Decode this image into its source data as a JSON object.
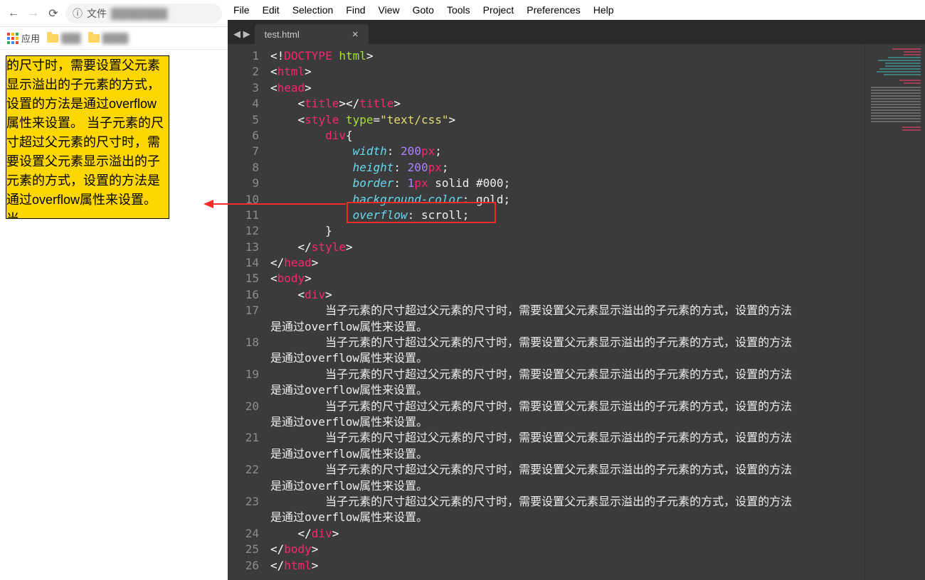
{
  "browser": {
    "address_prefix": "文件",
    "apps_label": "应用",
    "rendered_text": "的尺寸时，需要设置父元素显示溢出的子元素的方式，设置的方法是通过overflow属性来设置。 当子元素的尺寸超过父元素的尺寸时，需要设置父元素显示溢出的子元素的方式，设置的方法是通过overflow属性来设置。 当"
  },
  "editor": {
    "menus": [
      "File",
      "Edit",
      "Selection",
      "Find",
      "View",
      "Goto",
      "Tools",
      "Project",
      "Preferences",
      "Help"
    ],
    "tab_title": "test.html",
    "code_lines": [
      {
        "n": 1,
        "html": "<span class='t-angle'>&lt;!</span><span class='t-kw'>DOCTYPE</span> <span class='t-attr'>html</span><span class='t-angle'>&gt;</span>"
      },
      {
        "n": 2,
        "html": "<span class='t-angle'>&lt;</span><span class='t-tag'>html</span><span class='t-angle'>&gt;</span>"
      },
      {
        "n": 3,
        "html": "<span class='t-angle'>&lt;</span><span class='t-tag'>head</span><span class='t-angle'>&gt;</span>"
      },
      {
        "n": 4,
        "html": "    <span class='t-angle'>&lt;</span><span class='t-tag'>title</span><span class='t-angle'>&gt;&lt;/</span><span class='t-tag'>title</span><span class='t-angle'>&gt;</span>"
      },
      {
        "n": 5,
        "html": "    <span class='t-angle'>&lt;</span><span class='t-tag'>style</span> <span class='t-attr'>type</span><span class='t-punct'>=</span><span class='t-val'>\"text/css\"</span><span class='t-angle'>&gt;</span>"
      },
      {
        "n": 6,
        "html": "        <span class='t-tag'>div</span><span class='t-punct'>{</span>"
      },
      {
        "n": 7,
        "html": "            <span class='t-prop'>width</span><span class='t-punct'>:</span> <span class='t-num'>200</span><span class='t-unit'>px</span><span class='t-punct'>;</span>"
      },
      {
        "n": 8,
        "html": "            <span class='t-prop'>height</span><span class='t-punct'>:</span> <span class='t-num'>200</span><span class='t-unit'>px</span><span class='t-punct'>;</span>"
      },
      {
        "n": 9,
        "html": "            <span class='t-prop'>border</span><span class='t-punct'>:</span> <span class='t-num'>1</span><span class='t-unit'>px</span> <span class='t-plain'>solid</span> <span class='t-plain'>#000</span><span class='t-punct'>;</span>"
      },
      {
        "n": 10,
        "html": "            <span class='t-prop'>background-color</span><span class='t-punct'>:</span> <span class='t-plain'>gold</span><span class='t-punct'>;</span>"
      },
      {
        "n": 11,
        "html": "            <span class='t-prop'>overflow</span><span class='t-punct'>:</span> <span class='t-plain'>scroll</span><span class='t-punct'>;</span>"
      },
      {
        "n": 12,
        "html": "        <span class='t-punct'>}</span>"
      },
      {
        "n": 13,
        "html": "    <span class='t-angle'>&lt;/</span><span class='t-tag'>style</span><span class='t-angle'>&gt;</span>"
      },
      {
        "n": 14,
        "html": "<span class='t-angle'>&lt;/</span><span class='t-tag'>head</span><span class='t-angle'>&gt;</span>"
      },
      {
        "n": 15,
        "html": "<span class='t-angle'>&lt;</span><span class='t-tag'>body</span><span class='t-angle'>&gt;</span>"
      },
      {
        "n": 16,
        "html": "    <span class='t-angle'>&lt;</span><span class='t-tag'>div</span><span class='t-angle'>&gt;</span>"
      },
      {
        "n": 17,
        "wrap": 2,
        "html": "        <span class='t-plain'>当子元素的尺寸超过父元素的尺寸时，需要设置父元素显示溢出的子元素的方式，设置的方法是通过overflow属性来设置。</span>"
      },
      {
        "n": 18,
        "wrap": 2,
        "html": "        <span class='t-plain'>当子元素的尺寸超过父元素的尺寸时，需要设置父元素显示溢出的子元素的方式，设置的方法是通过overflow属性来设置。</span>"
      },
      {
        "n": 19,
        "wrap": 2,
        "html": "        <span class='t-plain'>当子元素的尺寸超过父元素的尺寸时，需要设置父元素显示溢出的子元素的方式，设置的方法是通过overflow属性来设置。</span>"
      },
      {
        "n": 20,
        "wrap": 2,
        "html": "        <span class='t-plain'>当子元素的尺寸超过父元素的尺寸时，需要设置父元素显示溢出的子元素的方式，设置的方法是通过overflow属性来设置。</span>"
      },
      {
        "n": 21,
        "wrap": 2,
        "html": "        <span class='t-plain'>当子元素的尺寸超过父元素的尺寸时，需要设置父元素显示溢出的子元素的方式，设置的方法是通过overflow属性来设置。</span>"
      },
      {
        "n": 22,
        "wrap": 2,
        "html": "        <span class='t-plain'>当子元素的尺寸超过父元素的尺寸时，需要设置父元素显示溢出的子元素的方式，设置的方法是通过overflow属性来设置。</span>"
      },
      {
        "n": 23,
        "wrap": 2,
        "html": "        <span class='t-plain'>当子元素的尺寸超过父元素的尺寸时，需要设置父元素显示溢出的子元素的方式，设置的方法是通过overflow属性来设置。</span>"
      },
      {
        "n": 24,
        "html": "    <span class='t-angle'>&lt;/</span><span class='t-tag'>div</span><span class='t-angle'>&gt;</span>"
      },
      {
        "n": 25,
        "html": "<span class='t-angle'>&lt;/</span><span class='t-tag'>body</span><span class='t-angle'>&gt;</span>"
      },
      {
        "n": 26,
        "html": "<span class='t-angle'>&lt;/</span><span class='t-tag'>html</span><span class='t-angle'>&gt;</span>"
      }
    ]
  }
}
